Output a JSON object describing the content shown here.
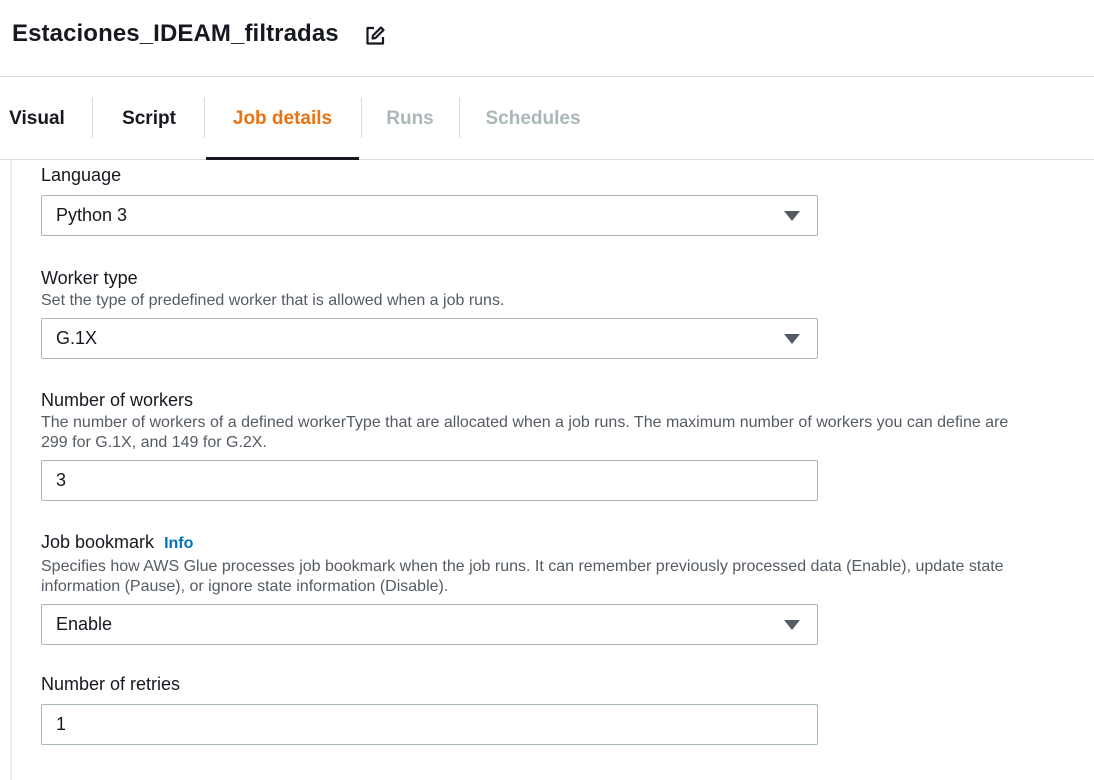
{
  "header": {
    "title": "Estaciones_IDEAM_filtradas",
    "edit_icon": "edit-icon"
  },
  "tabs": [
    {
      "label": "Visual",
      "state": "normal"
    },
    {
      "label": "Script",
      "state": "normal"
    },
    {
      "label": "Job details",
      "state": "active"
    },
    {
      "label": "Runs",
      "state": "disabled"
    },
    {
      "label": "Schedules",
      "state": "disabled"
    }
  ],
  "fields": {
    "language": {
      "label": "Language",
      "value": "Python 3"
    },
    "worker_type": {
      "label": "Worker type",
      "description": "Set the type of predefined worker that is allowed when a job runs.",
      "value": "G.1X"
    },
    "number_of_workers": {
      "label": "Number of workers",
      "description_line1": "The number of workers of a defined workerType that are allocated when a job runs. The maximum number of workers you can define are",
      "description_line2": "299 for G.1X, and 149 for G.2X.",
      "value": "3"
    },
    "job_bookmark": {
      "label": "Job bookmark",
      "info": "Info",
      "description_line1": "Specifies how AWS Glue processes job bookmark when the job runs. It can remember previously processed data (Enable), update state",
      "description_line2": "information (Pause), or ignore state information (Disable).",
      "value": "Enable"
    },
    "number_of_retries": {
      "label": "Number of retries",
      "value": "1"
    }
  },
  "colors": {
    "accent": "#ec7211",
    "link": "#0073bb",
    "disabled": "#aab7b8",
    "border": "#aab7b8"
  }
}
